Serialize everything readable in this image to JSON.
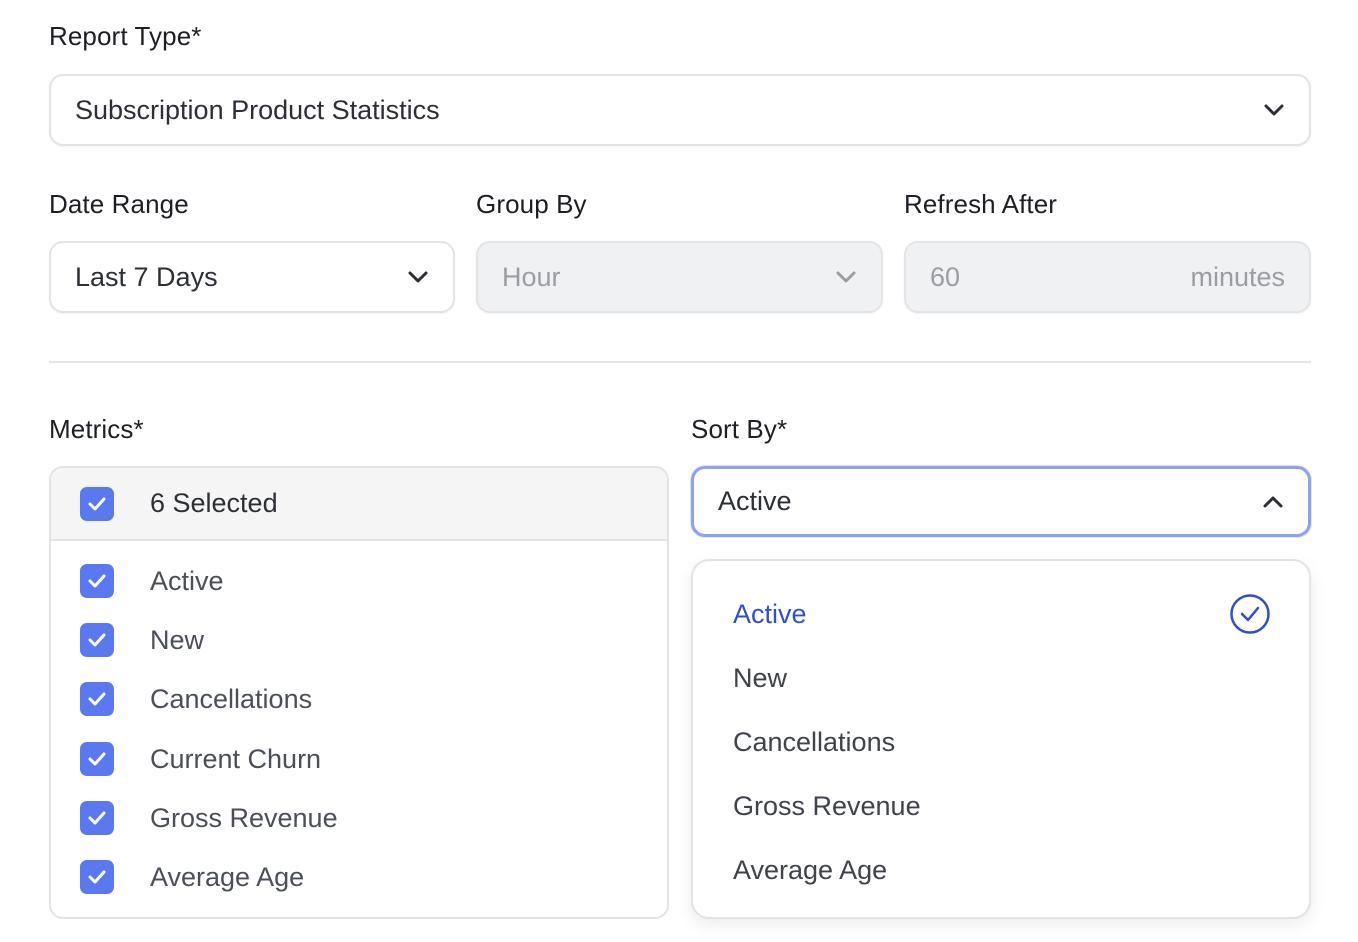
{
  "report_type": {
    "label": "Report Type*",
    "value": "Subscription Product Statistics"
  },
  "date_range": {
    "label": "Date Range",
    "value": "Last 7 Days"
  },
  "group_by": {
    "label": "Group By",
    "value": "Hour"
  },
  "refresh_after": {
    "label": "Refresh After",
    "value": "60",
    "suffix": "minutes"
  },
  "metrics": {
    "label": "Metrics*",
    "summary": "6 Selected",
    "items": [
      "Active",
      "New",
      "Cancellations",
      "Current Churn",
      "Gross Revenue",
      "Average Age"
    ]
  },
  "sort_by": {
    "label": "Sort By*",
    "value": "Active",
    "options": [
      "Active",
      "New",
      "Cancellations",
      "Gross Revenue",
      "Average Age"
    ]
  },
  "colors": {
    "accent": "#5b79ee",
    "selected_text": "#2e4fd0",
    "focus_border": "#8da2f0"
  },
  "icons": {
    "dropdown": "chevron-down-icon",
    "open_dropdown": "chevron-up-icon",
    "checkbox": "checkbox-checked-icon",
    "selected_option": "check-circle-icon"
  }
}
